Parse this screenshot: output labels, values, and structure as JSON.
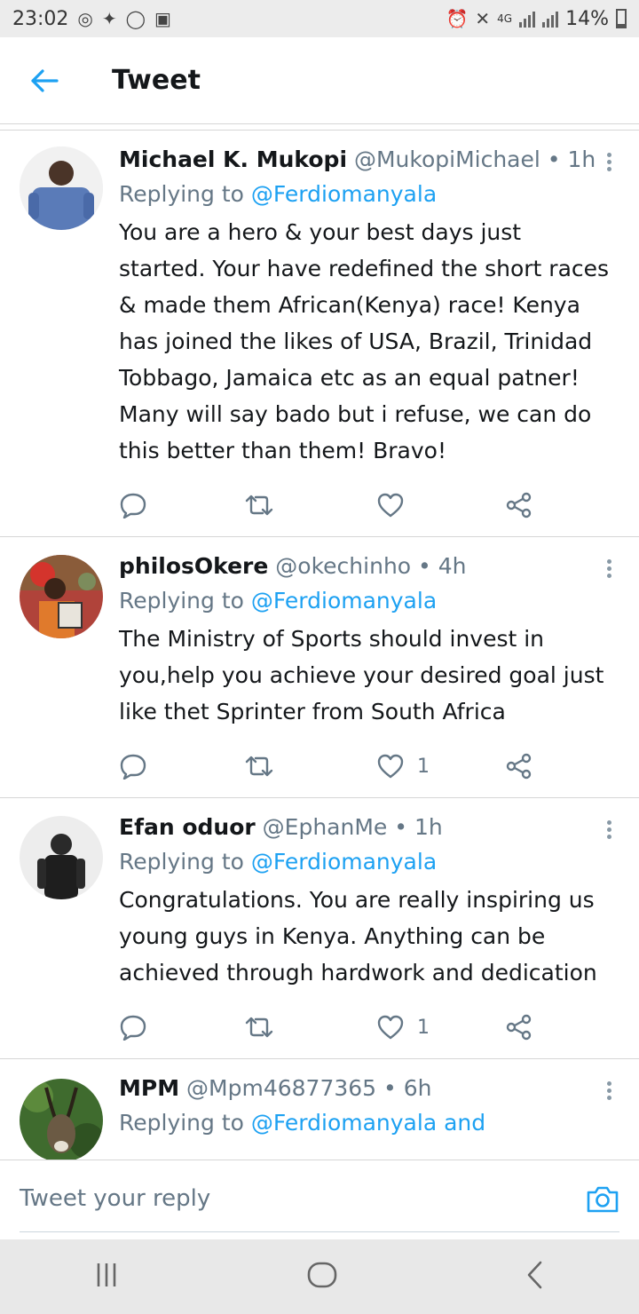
{
  "status_bar": {
    "time": "23:02",
    "network": "4G",
    "battery": "14%"
  },
  "header": {
    "title": "Tweet"
  },
  "tweets": [
    {
      "name": "Michael K. Mukopi",
      "handle": "@MukopiMichael",
      "dot": "•",
      "time": "1h",
      "replying_prefix": "Replying to",
      "replying_to": "@Ferdiomanyala",
      "text_lines": [
        "You are a hero & your best days just",
        "started. Your have redefined the short races",
        "& made them African(Kenya) race! Kenya",
        "has joined the likes of USA, Brazil, Trinidad",
        "Tobbago, Jamaica etc as an equal patner!",
        "Many will say bado but i refuse, we can do",
        "this better than them! Bravo!"
      ],
      "likes": ""
    },
    {
      "name": "philosOkere",
      "handle": "@okechinho",
      "dot": "•",
      "time": "4h",
      "replying_prefix": "Replying to",
      "replying_to": "@Ferdiomanyala",
      "text_lines": [
        "The Ministry of Sports should invest in",
        "you,help you achieve your desired goal just",
        "like thet Sprinter from South Africa"
      ],
      "likes": "1"
    },
    {
      "name": "Efan oduor",
      "handle": "@EphanMe",
      "dot": "•",
      "time": "1h",
      "replying_prefix": "Replying to",
      "replying_to": "@Ferdiomanyala",
      "text_lines": [
        "Congratulations. You are really inspiring us",
        "young guys in Kenya. Anything can be",
        "achieved through hardwork and dedication"
      ],
      "likes": "1"
    },
    {
      "name": "MPM",
      "handle": "@Mpm46877365",
      "dot": "•",
      "time": "6h",
      "replying_prefix": "Replying to",
      "replying_to": "@Ferdiomanyala and"
    }
  ],
  "reply_bar": {
    "placeholder": "Tweet your reply"
  },
  "icons": {
    "back": "arrow-left-icon",
    "more": "more-vertical-icon",
    "reply": "reply-icon",
    "retweet": "retweet-icon",
    "like": "heart-icon",
    "share": "share-icon",
    "camera": "camera-icon"
  },
  "colors": {
    "accent": "#1da1f2",
    "secondary_text": "#657786",
    "primary_text": "#14171a"
  }
}
